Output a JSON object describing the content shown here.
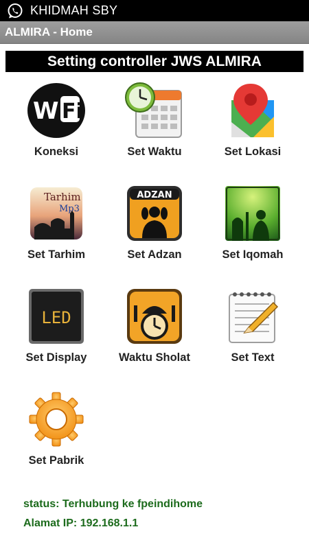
{
  "statusbar": {
    "notification_text": "KHIDMAH SBY",
    "icon": "whatsapp-icon"
  },
  "actionbar": {
    "title": "ALMIRA - Home"
  },
  "banner": {
    "text": "Setting controller JWS ALMIRA"
  },
  "menu": [
    {
      "label": "Koneksi",
      "icon": "wifi-icon"
    },
    {
      "label": "Set Waktu",
      "icon": "calendar-clock-icon"
    },
    {
      "label": "Set Lokasi",
      "icon": "map-pin-icon"
    },
    {
      "label": "Set Tarhim",
      "icon": "tarhim-mp3-icon",
      "icon_text": [
        "Tarhim",
        "Mp3"
      ]
    },
    {
      "label": "Set Adzan",
      "icon": "adzan-icon",
      "icon_text": "ADZAN"
    },
    {
      "label": "Set Iqomah",
      "icon": "mosque-prayer-icon"
    },
    {
      "label": "Set Display",
      "icon": "led-display-icon",
      "icon_text": "LED"
    },
    {
      "label": "Waktu Sholat",
      "icon": "mosque-clock-icon"
    },
    {
      "label": "Set Text",
      "icon": "notepad-pencil-icon"
    },
    {
      "label": "Set Pabrik",
      "icon": "gear-icon"
    }
  ],
  "status": {
    "connection": "status: Terhubung ke fpeindihome",
    "ip": "Alamat IP: 192.168.1.1"
  },
  "colors": {
    "status_text": "#1c6b1c",
    "banner_bg": "#000000",
    "actionbar_bg": "#8f8f8f"
  }
}
